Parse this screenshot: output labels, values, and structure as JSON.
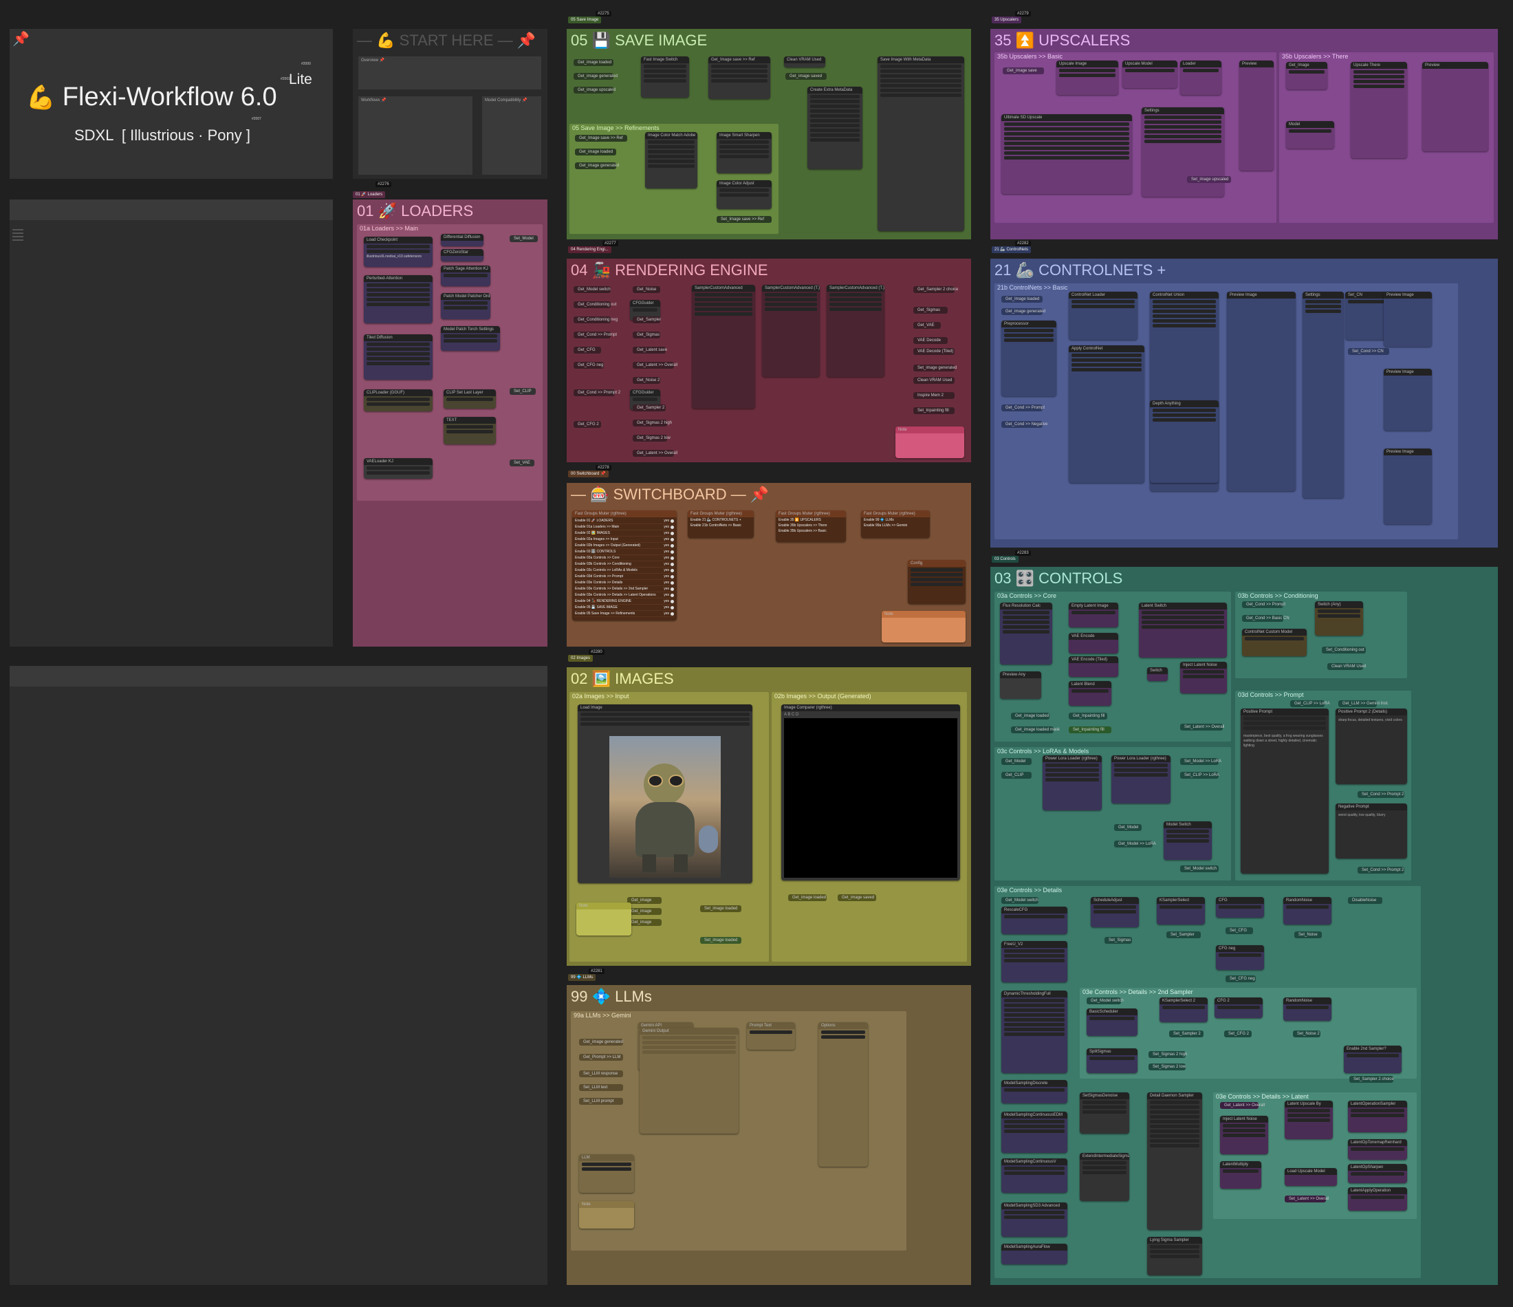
{
  "colors": {
    "canvas": "#202020",
    "save": "#4b6b35",
    "loaders": "#7a3f5b",
    "render": "#6b2d3e",
    "switch": "#7a5136",
    "images": "#7c7c37",
    "llms": "#6f5e3d",
    "upscalers": "#6e3c79",
    "controlnets": "#3f4c7c",
    "controls": "#2f6659"
  },
  "title_card": {
    "pin": "📌",
    "emoji": "💪",
    "title": "Flexi-Workflow 6.0",
    "suffix": "Lite",
    "subtitle": "SDXL  [ Illustrious · Pony ]",
    "id_a": "#2000",
    "id_b": "#2001",
    "id_c": "#2007"
  },
  "start_here": {
    "title": "— 💪 START HERE — 📌",
    "note1": "Overview 📌",
    "note2": "Workflows 📌",
    "note3": "Model Compatibility 📌"
  },
  "groups": {
    "save": {
      "title": "05 💾 SAVE IMAGE",
      "tag": "05 Save Image",
      "id": "#2275"
    },
    "loaders": {
      "title": "01 🚀 LOADERS",
      "tag": "01 🚀 Loaders",
      "id": "#2276"
    },
    "render": {
      "title": "04 🚂 RENDERING ENGINE",
      "tag": "04 Rendering Engi...",
      "id": "#2277"
    },
    "switch": {
      "title": "— 🎰 SWITCHBOARD — 📌",
      "tag": "00 Switchboard 📌",
      "id": "#2278"
    },
    "images": {
      "title": "02 🖼️ IMAGES",
      "tag": "02 Images",
      "id": "#2280"
    },
    "llms": {
      "title": "99 💠 LLMs",
      "tag": "99 💠 LLMs",
      "id": "#2281"
    },
    "upscalers": {
      "title": "35 ⏫ UPSCALERS",
      "tag": "35 Upscalers",
      "id": "#2279"
    },
    "controlnets": {
      "title": "21 🦾 CONTROLNETS +",
      "tag": "21 🦾 ControlNets",
      "id": "#2282"
    },
    "controls": {
      "title": "03 🎛️ CONTROLS",
      "tag": "03 Controls",
      "id": "#2283"
    }
  },
  "subgroups": {
    "loaders_main": "01a Loaders >> Main",
    "save_refine": "05 Save Image >> Refinements",
    "upscale_basic": "35b Upscalers >> Basic",
    "upscale_there": "35b Upscalers >> There",
    "controlnet_basic": "21b ControlNets >> Basic",
    "img_input": "02a Images >> Input",
    "img_output": "02b Images >> Output (Generated)",
    "llm_gemini": "99a LLMs >> Gemini",
    "ctrl_core": "03a Controls >> Core",
    "ctrl_cond": "03b Controls >> Conditioning",
    "ctrl_prompt": "03d Controls >> Prompt",
    "ctrl_lora": "03c Controls >> LoRAs & Models",
    "ctrl_details": "03e Controls >> Details",
    "ctrl_sampler": "03e Controls >> Details >> 2nd Sampler",
    "ctrl_latent": "03e Controls >> Details >> Latent"
  },
  "nodes": {
    "load_checkpoint": "Load Checkpoint",
    "checkpoint_file": "illustriousXLnoobai_v10.safetensors",
    "diffusion_differ": "Differential Diffusion",
    "cfg_zero": "CFGZeroStar",
    "patch_sage": "Patch Sage Attention KJ",
    "perturb": "Perturbed-Attention",
    "patch_order": "Patch Model Patcher Order",
    "tdd": "Tiled Diffusion",
    "model_patch": "Model Patch Torch Settings",
    "clip_loader": "CLIPLoader (GGUF)",
    "clip_set_last": "CLIP Set Last Layer",
    "vae_loader": "VAELoader KJ",
    "set_model": "Set_Model",
    "set_clip": "Set_CLIP",
    "set_vae": "Set_VAE",
    "save_with_meta": "Save Image With MetaData",
    "image_switch": "Fast Image Switch",
    "clean_vram": "Clean VRAM Used",
    "create_meta": "Create Extra MetaData",
    "upscale_blur": "Image Color Match Adobe",
    "image_sharpen": "Image Smart Sharpen",
    "ksampler_a": "SamplerCustomAdvanced",
    "ksampler_b": "SamplerCustomAdvanced (T.)",
    "ksampler_c": "SamplerCustomAdvanced (T.)",
    "preview_image": "Preview Image",
    "image_compare": "Image Comparer (rgthree)",
    "fast_groups_muter": "Fast Groups Muter (rgthree)",
    "empty_latent": "Empty Latent Image",
    "vae_encode": "VAE Encode",
    "latent_switch": "Latent Switch",
    "positive_prompt": "Positive Prompt",
    "negative_prompt": "Negative Prompt",
    "power_lora": "Power Lora Loader (rgthree)",
    "model_switch": "Model Switch",
    "ksampler_select": "KSamplerSelect",
    "basic_scheduler": "BasicScheduler",
    "random_noise": "RandomNoise",
    "cfg_guider": "CFGGuider",
    "split_sigmas": "SplitSigmas",
    "latent_upscale": "Latent Upscale By",
    "detail_daemon": "Detail Daemon Sampler"
  },
  "switchboard": {
    "header": "Fast Groups Muter (rgthree)",
    "rows": [
      "Enable 01 🚀 LOADERS",
      "Enable 01a Loaders >> Main",
      "Enable 02 🖼️ IMAGES",
      "Enable 02a Images >> Input",
      "Enable 02b Images >> Output (Generated)",
      "Enable 03 🎛️ CONTROLS",
      "Enable 03a Controls >> Core",
      "Enable 03b Controls >> Conditioning",
      "Enable 03c Controls >> LoRAs & Models",
      "Enable 03d Controls >> Prompt",
      "Enable 03e Controls >> Details",
      "Enable 03e Controls >> Details >> 2nd Sampler",
      "Enable 03e Controls >> Details >> Latent Operations",
      "Enable 04 🚂 RENDERING ENGINE",
      "Enable 05 💾 SAVE IMAGE",
      "Enable 05 Save Image >> Refinements"
    ],
    "toggle": "yes",
    "mini_a_row1": "Enable 21 🦾 CONTROLNETS +",
    "mini_a_row2": "Enable 21b ControlNets >> Basic",
    "mini_b_row1": "Enable 35 ⏫ UPSCALERS",
    "mini_b_row2": "Enable 35b Upscalers >> There",
    "mini_c_row1": "Enable 99 💠 LLMs",
    "mini_c_row2": "Enable 99a LLMs >> Gemini",
    "mini_d_row1": "Enable 35b Upscalers >> Basic"
  }
}
